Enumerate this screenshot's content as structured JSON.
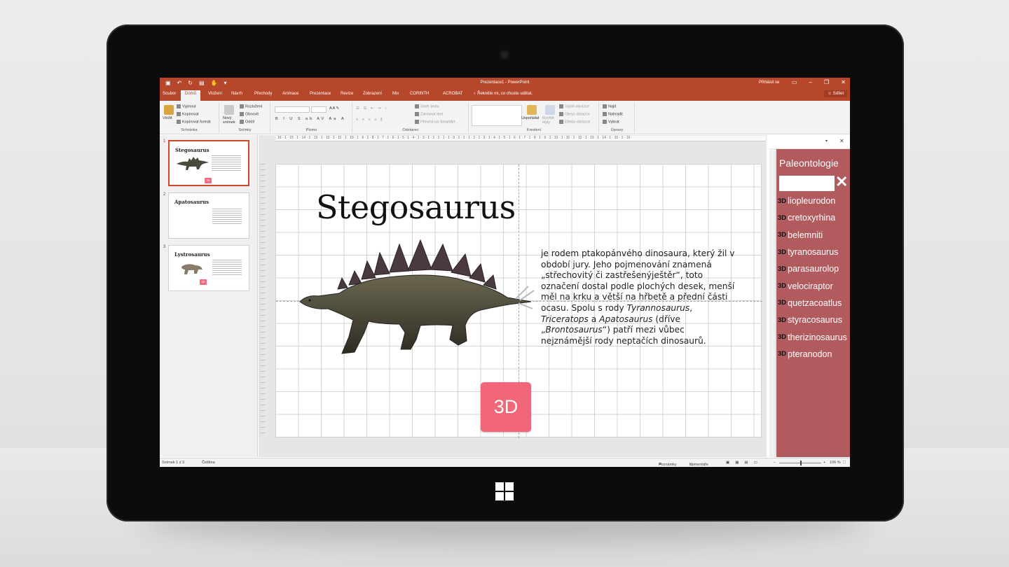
{
  "app": {
    "window_title": "Prezentace1 - PowerPoint",
    "sign_in": "Přihlásit se",
    "share": "Sdílet",
    "tell_me": "Řekněte mi, co chcete udělat."
  },
  "tabs": [
    "Soubor",
    "Domů",
    "Vložení",
    "Návrh",
    "Přechody",
    "Animace",
    "Prezentace",
    "Revize",
    "Zobrazení",
    "Mix",
    "CORINTH",
    "ACROBAT"
  ],
  "ribbon": {
    "clipboard": {
      "paste": "Vložit",
      "cut": "Vyjmout",
      "copy": "Kopírovat",
      "format": "Kopírovat formát",
      "label": "Schránka"
    },
    "slides": {
      "new_slide": "Nový snímek",
      "layout": "Rozložení",
      "reset": "Obnovit",
      "section": "Oddíl",
      "label": "Snímky"
    },
    "font": {
      "label": "Písmo"
    },
    "paragraph": {
      "direction": "Směr textu",
      "align": "Zarovnat text",
      "smartart": "Převést na SmartArt",
      "label": "Odstavec"
    },
    "drawing": {
      "arrange": "Uspořádat",
      "quick_styles": "Rychlé styly",
      "fill": "Výplň obrazce",
      "outline": "Obrys obrazce",
      "effects": "Efekty obrazce",
      "label": "Kreslení"
    },
    "editing": {
      "find": "Najít",
      "replace": "Nahradit",
      "select": "Vybrat",
      "label": "Úpravy"
    }
  },
  "thumbnails": [
    {
      "num": "1",
      "title": "Stegosaurus"
    },
    {
      "num": "2",
      "title": "Apatosaurus"
    },
    {
      "num": "3",
      "title": "Lystrosaurus"
    }
  ],
  "slide": {
    "title": "Stegosaurus",
    "badge": "3D",
    "body_1": "je rodem ptakopánvého dinosaura, který žil v období jury. Jeho pojmenování znamená „střechovitý či zastřešenýještěr“, toto označení dostal podle plochých desek, menší měl na krku a větší na hřbetě a přední části ocasu. Spolu s rody ",
    "body_tyr": "Tyrannosaurus",
    "body_sep1": ", ",
    "body_tri": "Triceratops",
    "body_sep2": " a ",
    "body_apa": "Apatosaurus",
    "body_2": " (dříve „",
    "body_bro": "Brontosaurus",
    "body_3": "“) patří mezi vůbec nejznámější rody neptačích dinosaurů."
  },
  "ruler": "· 16 · 1 · 15 · 1 · 14 · 1 · 13 · 1 · 12 · 1 · 11 · 1 · 10 · 1 · 9 · 1 · 8 · 1 · 7 · 1 · 6 · 1 · 5 · 1 · 4 · 1 · 3 · 1 · 2 · 1 · 1 · 1 · 0 · 1 · 1 · 1 · 2 · 1 · 3 · 1 · 4 · 1 · 5 · 1 · 6 · 1 · 7 · 1 · 8 · 1 · 9 · 1 · 10 · 1 · 11 · 1 · 12 · 1 · 13 · 1 · 14 · 1 · 15 · 1 · 16 ·",
  "pane": {
    "title": "Paleontologie",
    "prefix": "3D",
    "items": [
      "liopleurodon",
      "cretoxyrhina",
      "belemniti",
      "tyranosaurus",
      "parasaurolop",
      "velociraptor",
      "quetzacoatlus",
      "styracosaurus",
      "therizinosaurus",
      "pteranodon"
    ]
  },
  "status": {
    "slide_count": "Snímek 1 z 3",
    "language": "Čeština",
    "notes": "Poznámky",
    "comments": "Komentáře",
    "zoom": "106 %"
  },
  "colors": {
    "accent": "#b7472a",
    "pane": "#b15b5f",
    "badge": "#f2667a"
  }
}
